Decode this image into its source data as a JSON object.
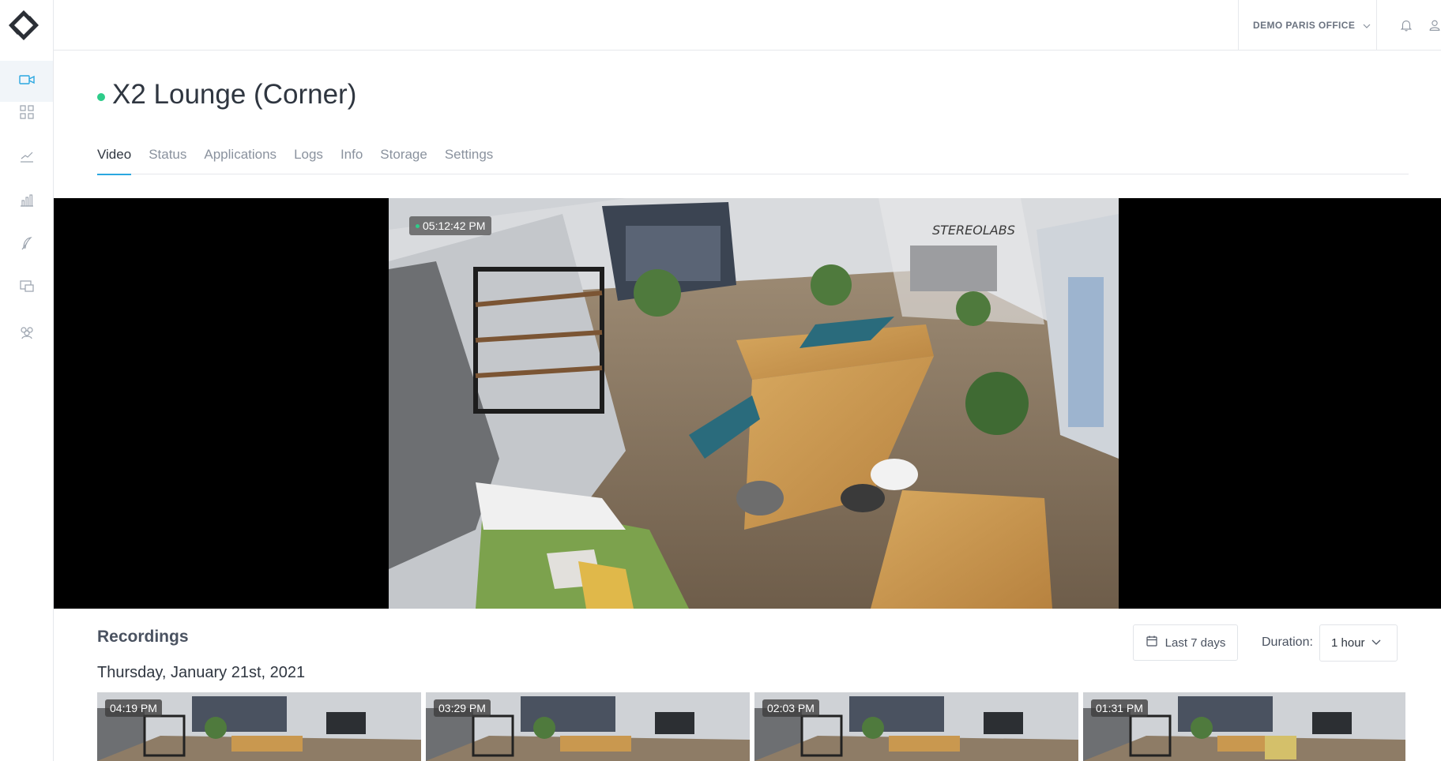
{
  "app": {
    "logo_icon": "stereolabs-logo-icon",
    "accent_color": "#2aa7e0",
    "status_color": "#2ecc8a"
  },
  "sidebar": {
    "items": [
      {
        "icon": "camera-icon",
        "active": true
      },
      {
        "icon": "grid-icon",
        "active": false
      },
      {
        "icon": "trend-chart-icon",
        "active": false
      },
      {
        "icon": "bar-chart-icon",
        "active": false
      },
      {
        "icon": "feather-icon",
        "active": false
      },
      {
        "icon": "devices-icon",
        "active": false
      },
      {
        "icon": "team-icon",
        "active": false
      }
    ]
  },
  "header": {
    "org_name": "DEMO PARIS OFFICE",
    "icons": [
      "bell-icon",
      "user-icon"
    ]
  },
  "camera": {
    "title": "X2 Lounge (Corner)",
    "status": "online"
  },
  "tabs": [
    {
      "label": "Video",
      "active": true
    },
    {
      "label": "Status",
      "active": false
    },
    {
      "label": "Applications",
      "active": false
    },
    {
      "label": "Logs",
      "active": false
    },
    {
      "label": "Info",
      "active": false
    },
    {
      "label": "Storage",
      "active": false
    },
    {
      "label": "Settings",
      "active": false
    }
  ],
  "live": {
    "timestamp": "05:12:42 PM",
    "wall_sign": "STEREOLABS"
  },
  "recordings": {
    "title": "Recordings",
    "range_label": "Last 7 days",
    "duration_label": "Duration:",
    "duration_value": "1 hour",
    "date_heading": "Thursday, January 21st, 2021",
    "thumbnails": [
      {
        "time": "04:19 PM"
      },
      {
        "time": "03:29 PM"
      },
      {
        "time": "02:03 PM"
      },
      {
        "time": "01:31 PM"
      }
    ]
  }
}
